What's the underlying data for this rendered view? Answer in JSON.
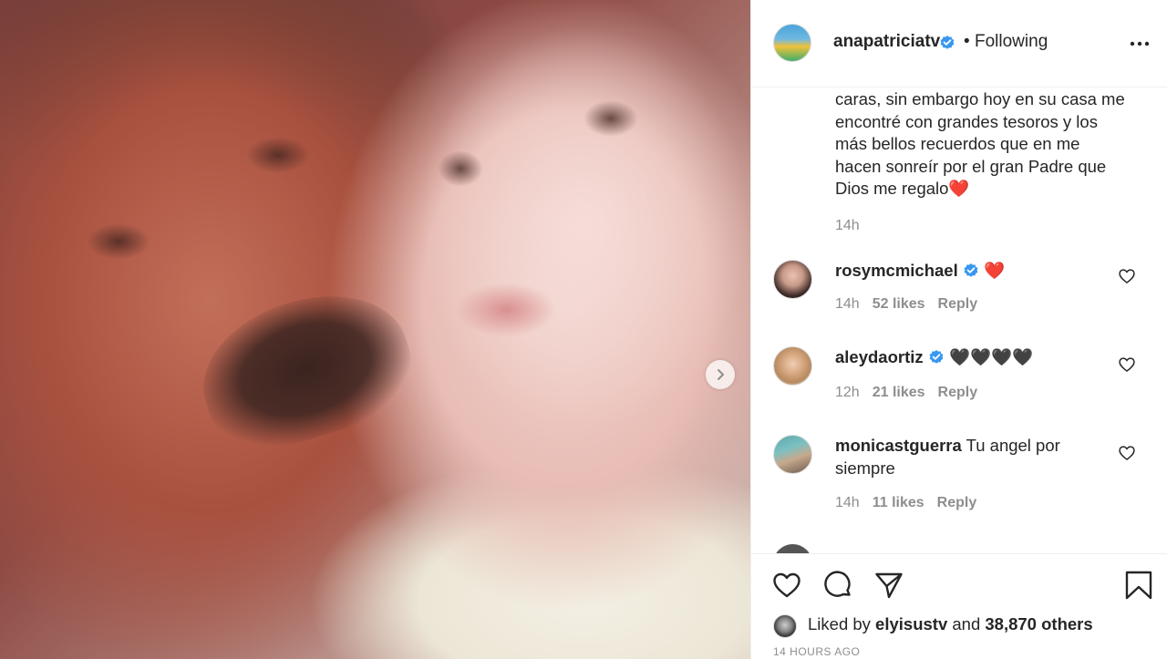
{
  "post": {
    "username": "anapatriciatv",
    "follow_status": "Following",
    "separator": "•",
    "caption_text": "caras, sin embargo hoy en su casa me encontré con grandes tesoros y los más bellos recuerdos que en me hacen sonreír por el gran Padre que Dios me regalo",
    "caption_emoji": "❤️",
    "caption_time": "14h"
  },
  "comments": [
    {
      "username": "rosymcmichael",
      "verified": true,
      "text": "❤️",
      "time": "14h",
      "likes": "52 likes",
      "reply": "Reply"
    },
    {
      "username": "aleydaortiz",
      "verified": true,
      "text": "🖤🖤🖤🖤",
      "time": "12h",
      "likes": "21 likes",
      "reply": "Reply"
    },
    {
      "username": "monicastguerra",
      "verified": false,
      "text": "Tu angel por siempre",
      "time": "14h",
      "likes": "11 likes",
      "reply": "Reply"
    }
  ],
  "liked_by": {
    "prefix": "Liked by",
    "user": "elyisustv",
    "middle": "and",
    "others": "38,870 others"
  },
  "timestamp": "14 HOURS AGO",
  "icons": {
    "next": "chevron-right-icon",
    "verified": "verified-badge-icon",
    "more": "more-options-icon",
    "like": "heart-icon",
    "comment": "comment-icon",
    "share": "paper-plane-icon",
    "save": "bookmark-icon"
  },
  "colors": {
    "verified": "#3897f0",
    "heart": "#ed4956",
    "muted": "#8e8e8e"
  }
}
